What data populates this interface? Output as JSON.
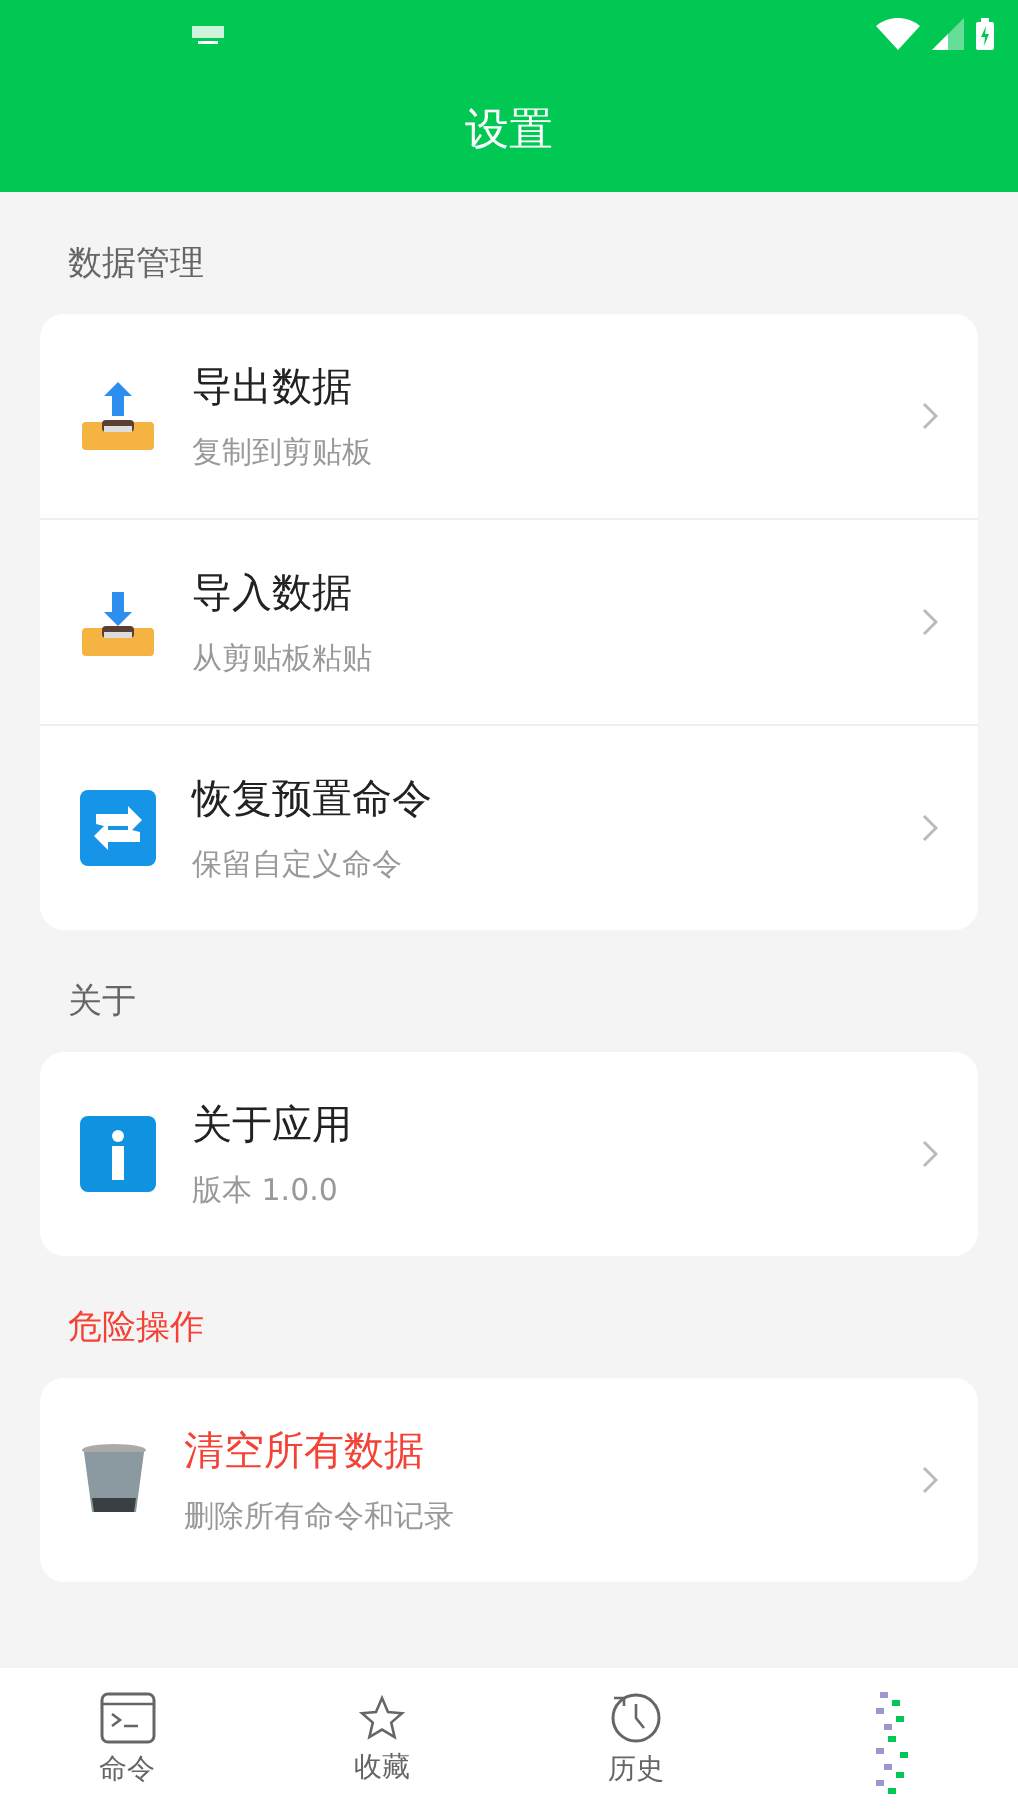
{
  "header": {
    "title": "设置"
  },
  "sections": [
    {
      "title": "数据管理",
      "danger": false,
      "items": [
        {
          "kind": "export",
          "title": "导出数据",
          "subtitle": "复制到剪贴板"
        },
        {
          "kind": "import",
          "title": "导入数据",
          "subtitle": "从剪贴板粘贴"
        },
        {
          "kind": "restore",
          "title": "恢复预置命令",
          "subtitle": "保留自定义命令"
        }
      ]
    },
    {
      "title": "关于",
      "danger": false,
      "items": [
        {
          "kind": "info",
          "title": "关于应用",
          "subtitle": "版本 1.0.0"
        }
      ]
    },
    {
      "title": "危险操作",
      "danger": true,
      "items": [
        {
          "kind": "trash",
          "title": "清空所有数据",
          "subtitle": "删除所有命令和记录"
        }
      ]
    }
  ],
  "tabs": [
    {
      "kind": "terminal",
      "label": "命令",
      "selected": false
    },
    {
      "kind": "star",
      "label": "收藏",
      "selected": false
    },
    {
      "kind": "history",
      "label": "历史",
      "selected": false
    },
    {
      "kind": "glitch",
      "selected": true
    }
  ]
}
